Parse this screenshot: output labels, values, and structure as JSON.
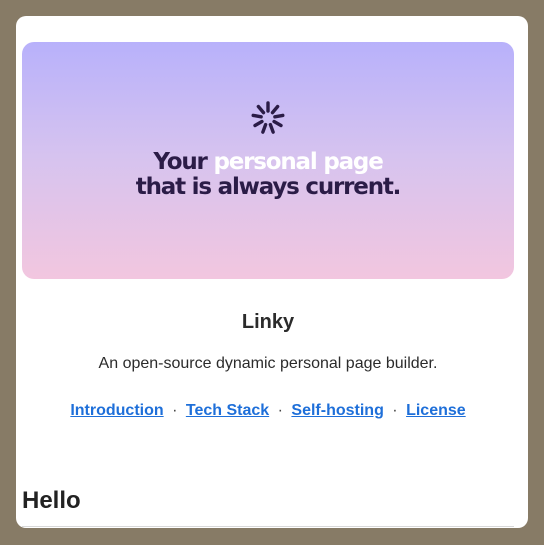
{
  "hero": {
    "title_prefix": "Your ",
    "title_accent": "personal page",
    "title_line2": "that is always current."
  },
  "project": {
    "title": "Linky",
    "description": "An open-source dynamic personal page builder."
  },
  "links": [
    {
      "label": "Introduction"
    },
    {
      "label": "Tech Stack"
    },
    {
      "label": "Self-hosting"
    },
    {
      "label": "License"
    }
  ],
  "separator": "·",
  "section": {
    "heading": "Hello"
  },
  "icons": {
    "hero": "spinner-icon"
  },
  "colors": {
    "background": "#877b66",
    "link": "#1e6fd9",
    "hero_text": "#2b1c47",
    "hero_gradient_top": "#b8b1fb",
    "hero_gradient_bottom": "#f2c6df"
  }
}
